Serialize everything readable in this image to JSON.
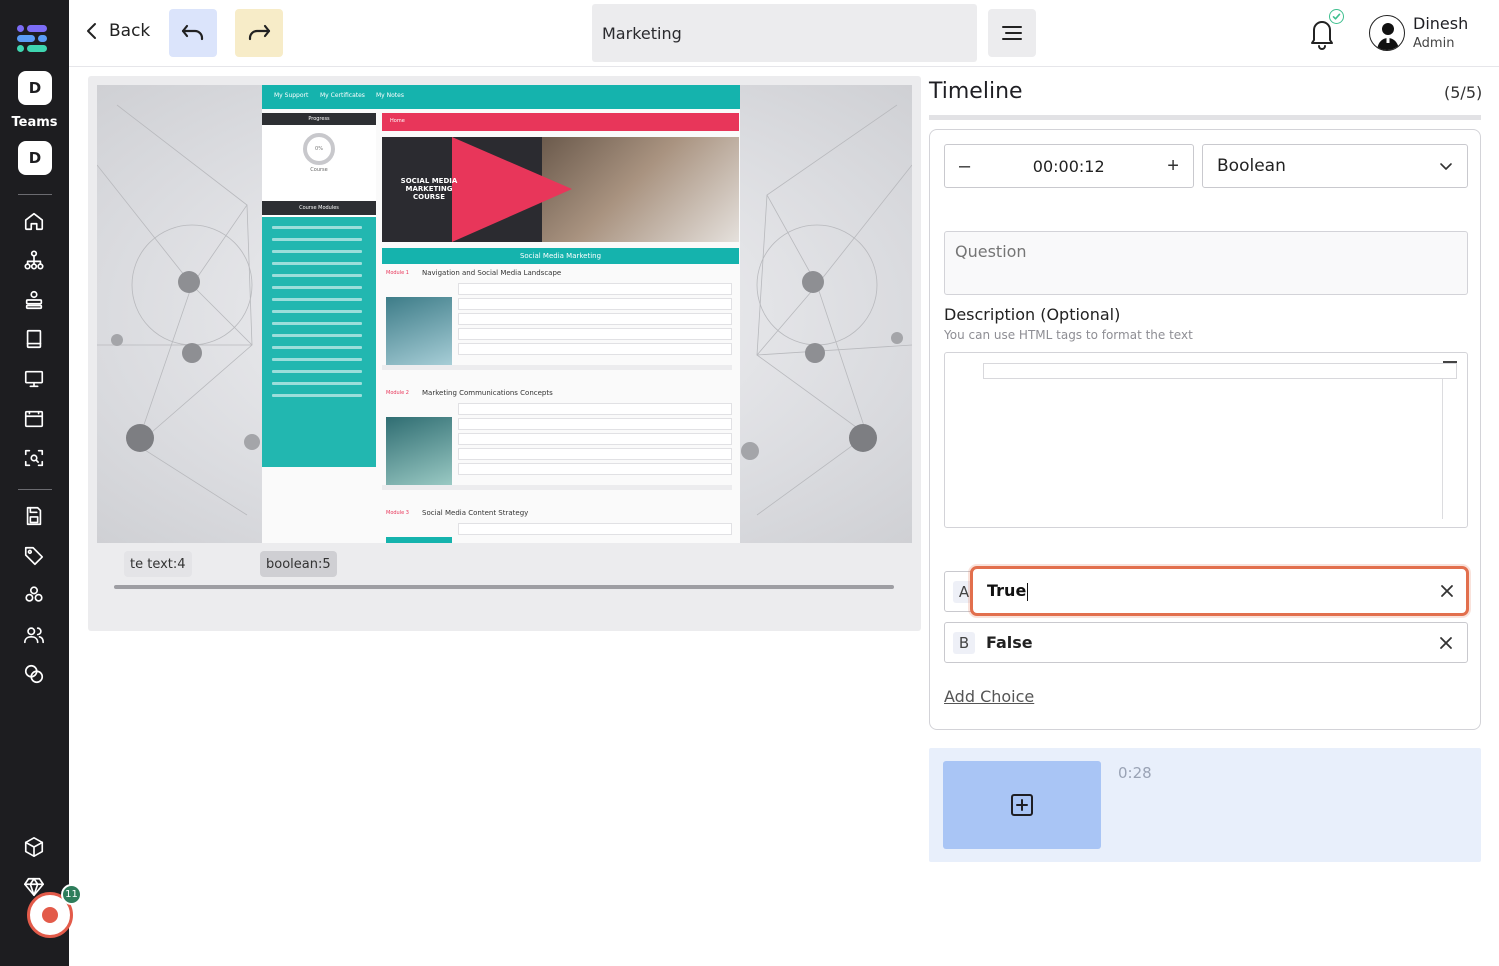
{
  "sidebar": {
    "team_initial_top": "D",
    "teams_label": "Teams",
    "team_initial": "D",
    "nav_icons": [
      "home-icon",
      "org-chart-icon",
      "stack-icon",
      "book-icon",
      "monitor-icon",
      "calendar-window-icon",
      "scan-icon",
      "save-icon",
      "tag-icon",
      "components-icon",
      "users-icon",
      "coins-icon",
      "package-icon",
      "diamond-icon"
    ],
    "record_badge_count": "11"
  },
  "topbar": {
    "back_label": "Back",
    "title_value": "Marketing",
    "user_name": "Dinesh",
    "user_role": "Admin"
  },
  "video": {
    "screen": {
      "nav_items": [
        "My Support",
        "My Certificates",
        "My Notes"
      ],
      "progress_header": "Progress",
      "progress_value": "0%",
      "progress_caption": "Course",
      "modules_header": "Course Modules",
      "breadcrumb": "Home",
      "hero_title": "SOCIAL MEDIA MARKETING COURSE",
      "band_title": "Social Media Marketing",
      "modules": [
        {
          "label": "Module 1",
          "title": "Navigation and Social Media Landscape"
        },
        {
          "label": "Module 2",
          "title": "Marketing Communications Concepts"
        },
        {
          "label": "Module 3",
          "title": "Social Media Content Strategy"
        }
      ]
    },
    "chips": [
      "te text:4",
      "boolean:5"
    ]
  },
  "timeline": {
    "title": "Timeline",
    "count": "(5/5)",
    "time_value": "00:00:12",
    "minus_label": "–",
    "plus_label": "+",
    "question_type": "Boolean",
    "question_placeholder": "Question",
    "description_label": "Description (Optional)",
    "description_hint": "You can use HTML tags to format the text",
    "choices": [
      {
        "letter": "A",
        "text": "True"
      },
      {
        "letter": "B",
        "text": "False"
      }
    ],
    "add_choice_label": "Add Choice",
    "strip_time": "0:28"
  },
  "colors": {
    "sidebar_bg": "#1d1d20",
    "undo_bg": "#dbe4fb",
    "redo_bg": "#f7ecc8",
    "focus_ring": "#e26f4d",
    "teal": "#15b3ad",
    "pink": "#e8365a",
    "add_slot": "#a9c5f5"
  }
}
